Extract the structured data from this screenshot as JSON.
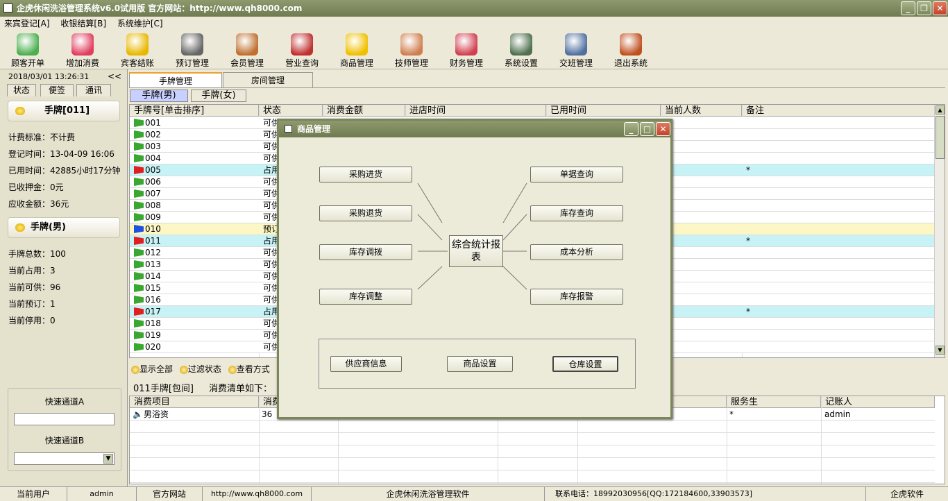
{
  "window": {
    "title": "企虎休闲洗浴管理系统v6.0试用版   官方网站：http://www.qh8000.com"
  },
  "menu": [
    "来宾登记[A]",
    "收银结算[B]",
    "系统维护[C]"
  ],
  "toolbar": [
    {
      "label": "顾客开单",
      "icon": "customer-icon",
      "color": "#4caf50"
    },
    {
      "label": "增加消费",
      "icon": "add-consume-icon",
      "color": "#e04060"
    },
    {
      "label": "宾客结账",
      "icon": "checkout-icon",
      "color": "#e8b800"
    },
    {
      "label": "预订管理",
      "icon": "alarm-clock-icon",
      "color": "#666666"
    },
    {
      "label": "会员管理",
      "icon": "members-icon",
      "color": "#c07030"
    },
    {
      "label": "营业查询",
      "icon": "calendar-icon",
      "color": "#c03030"
    },
    {
      "label": "商品管理",
      "icon": "star-icon",
      "color": "#f0c000"
    },
    {
      "label": "技师管理",
      "icon": "technicians-icon",
      "color": "#d08050"
    },
    {
      "label": "财务管理",
      "icon": "finance-icon",
      "color": "#d04050"
    },
    {
      "label": "系统设置",
      "icon": "settings-icon",
      "color": "#507050"
    },
    {
      "label": "交班管理",
      "icon": "handshake-icon",
      "color": "#5070a0"
    },
    {
      "label": "退出系统",
      "icon": "exit-icon",
      "color": "#c05020"
    }
  ],
  "left": {
    "datetime": "2018/03/01  13:26:31",
    "collapse": "<<",
    "tabs": [
      "状态",
      "便签",
      "通讯"
    ],
    "card1_title": "手牌[011]",
    "card1_lines": [
      "计费标准：不计费",
      "登记时间：13-04-09 16:06",
      "已用时间：42885小时17分钟",
      "已收押金：0元",
      "应收金额：36元"
    ],
    "card2_title": "手牌(男)",
    "card2_lines": [
      "手牌总数：100",
      "当前占用：3",
      "当前可供：96",
      "当前预订：1",
      "当前停用：0"
    ],
    "quickA": "快速通道A",
    "quickB": "快速通道B"
  },
  "main": {
    "tabs": [
      "手牌管理",
      "房间管理"
    ],
    "subtabs": [
      "手牌(男)",
      "手牌(女)"
    ],
    "columns": [
      "手牌号[单击排序]",
      "状态",
      "消费金额",
      "进店时间",
      "已用时间",
      "当前人数",
      "备注"
    ],
    "rows": [
      {
        "num": "001",
        "status": "可供",
        "note": "",
        "flag": "green",
        "bg": "#ffffff"
      },
      {
        "num": "002",
        "status": "可供",
        "note": "",
        "flag": "green",
        "bg": "#ffffff"
      },
      {
        "num": "003",
        "status": "可供",
        "note": "",
        "flag": "green",
        "bg": "#ffffff"
      },
      {
        "num": "004",
        "status": "可供",
        "note": "",
        "flag": "green",
        "bg": "#ffffff"
      },
      {
        "num": "005",
        "status": "占用",
        "note": "*",
        "flag": "red",
        "bg": "#c7f3f6"
      },
      {
        "num": "006",
        "status": "可供",
        "note": "",
        "flag": "green",
        "bg": "#ffffff"
      },
      {
        "num": "007",
        "status": "可供",
        "note": "",
        "flag": "green",
        "bg": "#ffffff"
      },
      {
        "num": "008",
        "status": "可供",
        "note": "",
        "flag": "green",
        "bg": "#ffffff"
      },
      {
        "num": "009",
        "status": "可供",
        "note": "",
        "flag": "green",
        "bg": "#ffffff"
      },
      {
        "num": "010",
        "status": "预订",
        "note": "",
        "flag": "blue",
        "bg": "#fcf7c4"
      },
      {
        "num": "011",
        "status": "占用",
        "note": "*",
        "flag": "red",
        "bg": "#c7f3f6"
      },
      {
        "num": "012",
        "status": "可供",
        "note": "",
        "flag": "green",
        "bg": "#ffffff"
      },
      {
        "num": "013",
        "status": "可供",
        "note": "",
        "flag": "green",
        "bg": "#ffffff"
      },
      {
        "num": "014",
        "status": "可供",
        "note": "",
        "flag": "green",
        "bg": "#ffffff"
      },
      {
        "num": "015",
        "status": "可供",
        "note": "",
        "flag": "green",
        "bg": "#ffffff"
      },
      {
        "num": "016",
        "status": "可供",
        "note": "",
        "flag": "green",
        "bg": "#ffffff"
      },
      {
        "num": "017",
        "status": "占用",
        "note": "*",
        "flag": "red",
        "bg": "#c7f3f6"
      },
      {
        "num": "018",
        "status": "可供",
        "note": "",
        "flag": "green",
        "bg": "#ffffff"
      },
      {
        "num": "019",
        "status": "可供",
        "note": "",
        "flag": "green",
        "bg": "#ffffff"
      },
      {
        "num": "020",
        "status": "可供",
        "note": "",
        "flag": "green",
        "bg": "#ffffff"
      }
    ],
    "filters": [
      "显示全部",
      "过滤状态",
      "查看方式"
    ],
    "bill_caption": "011手牌[包间]",
    "bill_caption2": "消费清单如下：",
    "bill_columns": [
      "消费项目",
      "消费",
      "服务生",
      "记账人"
    ],
    "bill_row": {
      "item": "男浴资",
      "amount": "36",
      "waiter": "*",
      "clerk": "admin"
    }
  },
  "dialog": {
    "title": "商品管理",
    "left_buttons": [
      "采购进货",
      "采购退货",
      "库存调拨",
      "库存调整"
    ],
    "right_buttons": [
      "单据查询",
      "库存查询",
      "成本分析",
      "库存报警"
    ],
    "center": "综合统计报表",
    "bottom_buttons": [
      "供应商信息",
      "商品设置",
      "仓库设置"
    ]
  },
  "status": {
    "user_label": "当前用户",
    "user": "admin",
    "site_label": "官方网站",
    "site": "http://www.qh8000.com",
    "product": "企虎休闲洗浴管理软件",
    "phone": "联系电话：18992030956[QQ:172184600,33903573]",
    "brand": "企虎软件"
  }
}
